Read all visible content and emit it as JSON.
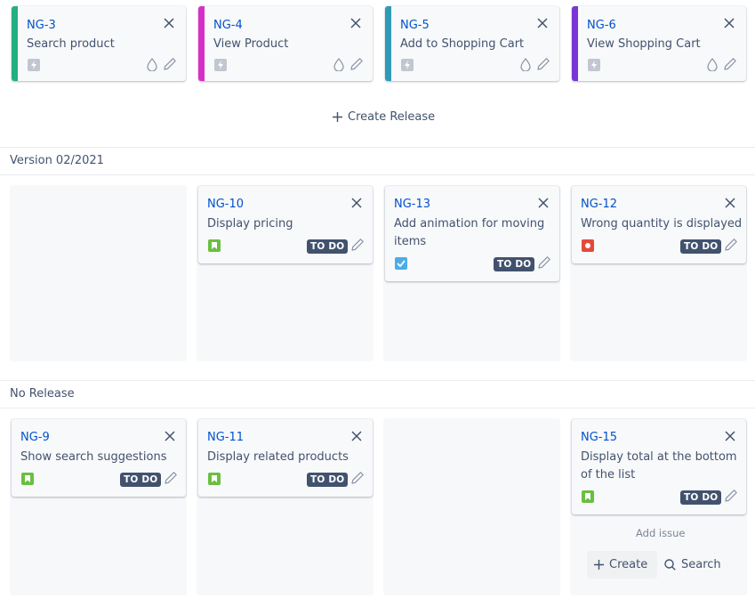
{
  "top_row": {
    "cards": [
      {
        "key": "NG-3",
        "summary": "Search product",
        "stripe_color": "#21b07f",
        "type_icon": "epic-bolt-icon"
      },
      {
        "key": "NG-4",
        "summary": "View Product",
        "stripe_color": "#d62fc9",
        "type_icon": "epic-bolt-icon"
      },
      {
        "key": "NG-5",
        "summary": "Add to Shopping Cart",
        "stripe_color": "#2f9ab5",
        "type_icon": "epic-bolt-icon"
      },
      {
        "key": "NG-6",
        "summary": "View Shopping Cart",
        "stripe_color": "#7a35d6",
        "type_icon": "epic-bolt-icon"
      }
    ],
    "create_release_label": "Create Release"
  },
  "sections": [
    {
      "title": "Version 02/2021",
      "cards": [
        {
          "key": "NG-10",
          "summary": "Display pricing",
          "type": "story",
          "status": "TO DO"
        },
        {
          "key": "NG-13",
          "summary": "Add animation for moving items",
          "type": "task",
          "status": "TO DO"
        },
        {
          "key": "NG-12",
          "summary": "Wrong quantity is displayed",
          "type": "bug",
          "status": "TO DO"
        }
      ]
    },
    {
      "title": "No Release",
      "cards": [
        {
          "key": "NG-9",
          "summary": "Show search suggestions",
          "type": "story",
          "status": "TO DO"
        },
        {
          "key": "NG-11",
          "summary": "Display related products",
          "type": "story",
          "status": "TO DO"
        },
        {
          "key": "NG-15",
          "summary": "Display total at the bottom of the list",
          "type": "story",
          "status": "TO DO"
        }
      ],
      "add_issue": {
        "label": "Add issue",
        "create_label": "Create",
        "search_label": "Search"
      }
    }
  ],
  "colors": {
    "story": "#6abf40",
    "task": "#4bade8",
    "bug": "#e5493a",
    "status_badge": "#42526e",
    "link": "#0052cc"
  }
}
